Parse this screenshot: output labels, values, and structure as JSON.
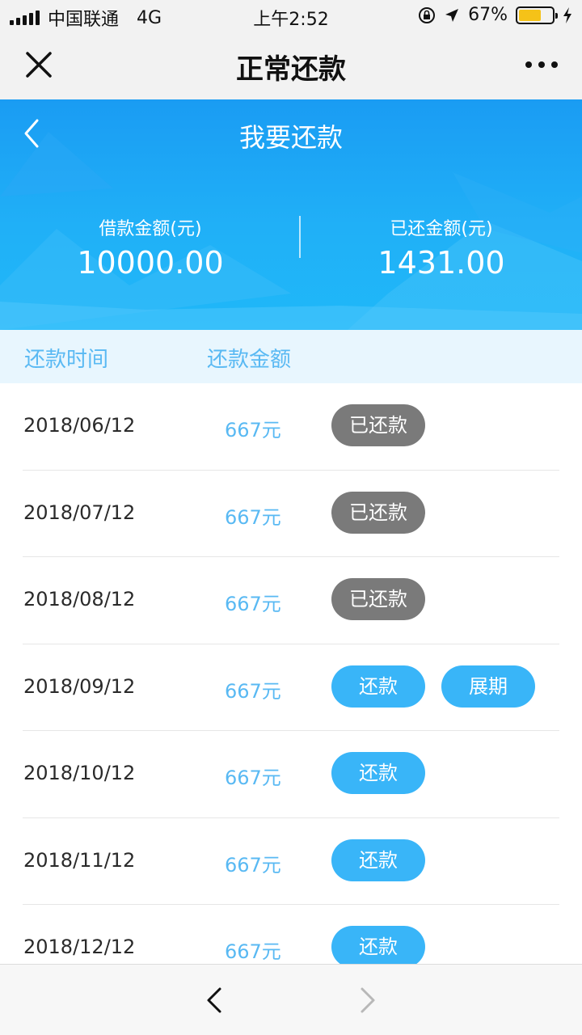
{
  "status_bar": {
    "carrier": "中国联通",
    "network": "4G",
    "time": "上午2:52",
    "battery": "67%",
    "battery_level": 0.67,
    "battery_color": "#f5c218"
  },
  "nav": {
    "title": "正常还款",
    "close_icon": "close-icon",
    "more_icon": "more-dots-icon"
  },
  "header": {
    "title": "我要还款",
    "back_icon": "chevron-left-icon",
    "loan_label": "借款金额(元)",
    "loan_amount": "10000.00",
    "repaid_label": "已还金额(元)",
    "repaid_amount": "1431.00",
    "accent_color": "#1a9cf3"
  },
  "table": {
    "col_date": "还款时间",
    "col_amount": "还款金额",
    "rows": [
      {
        "date": "2018/06/12",
        "amount": "667元",
        "action": "已还款",
        "status": "paid"
      },
      {
        "date": "2018/07/12",
        "amount": "667元",
        "action": "已还款",
        "status": "paid"
      },
      {
        "date": "2018/08/12",
        "amount": "667元",
        "action": "已还款",
        "status": "paid"
      },
      {
        "date": "2018/09/12",
        "amount": "667元",
        "action": "还款",
        "status": "due",
        "extend": "展期"
      },
      {
        "date": "2018/10/12",
        "amount": "667元",
        "action": "还款",
        "status": "due"
      },
      {
        "date": "2018/11/12",
        "amount": "667元",
        "action": "还款",
        "status": "due"
      },
      {
        "date": "2018/12/12",
        "amount": "667元",
        "action": "还款",
        "status": "due"
      }
    ],
    "paid_color": "#7a7a7a",
    "due_color": "#39b5f8"
  },
  "toolbar": {
    "prev_icon": "chevron-left-icon",
    "next_icon": "chevron-right-icon"
  }
}
